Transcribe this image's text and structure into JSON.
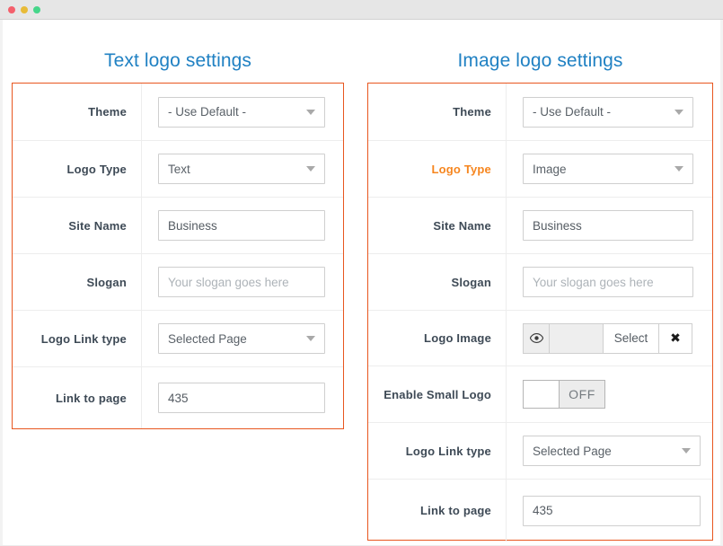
{
  "window": {
    "buttons": [
      {
        "name": "close",
        "color": "#f4606c"
      },
      {
        "name": "minimize",
        "color": "#e8bb38"
      },
      {
        "name": "maximize",
        "color": "#46d68a"
      }
    ]
  },
  "colors": {
    "panel_border": "#e8561f",
    "title": "#2081c3",
    "label": "#3e4a56",
    "accent_label": "#f6861f",
    "placeholder": "#adb3b8"
  },
  "panels": [
    {
      "id": "text-logo",
      "title": "Text logo settings",
      "rows": [
        {
          "label": "Theme",
          "accent": false,
          "control": "select",
          "value": "- Use Default -"
        },
        {
          "label": "Logo Type",
          "accent": false,
          "control": "select",
          "value": "Text"
        },
        {
          "label": "Site Name",
          "accent": false,
          "control": "input",
          "value": "Business",
          "placeholder": ""
        },
        {
          "label": "Slogan",
          "accent": false,
          "control": "input",
          "value": "",
          "placeholder": "Your slogan goes here"
        },
        {
          "label": "Logo Link type",
          "accent": false,
          "control": "select",
          "value": "Selected Page"
        },
        {
          "label": "Link to page",
          "accent": false,
          "control": "input",
          "value": "435",
          "placeholder": ""
        }
      ]
    },
    {
      "id": "image-logo",
      "title": "Image logo settings",
      "rows": [
        {
          "label": "Theme",
          "accent": false,
          "control": "select",
          "value": "- Use Default -"
        },
        {
          "label": "Logo Type",
          "accent": true,
          "control": "select",
          "value": "Image"
        },
        {
          "label": "Site Name",
          "accent": false,
          "control": "input",
          "value": "Business",
          "placeholder": ""
        },
        {
          "label": "Slogan",
          "accent": false,
          "control": "input",
          "value": "",
          "placeholder": "Your slogan goes here"
        },
        {
          "label": "Logo Image",
          "accent": false,
          "control": "filepicker",
          "preview_icon": "eye-icon",
          "preview_glyph": "ƒ",
          "file_value": "",
          "select_label": "Select",
          "clear_glyph": "✖"
        },
        {
          "label": "Enable Small Logo",
          "accent": false,
          "control": "toggle",
          "state_label": "OFF",
          "state": "off"
        },
        {
          "label": "Logo Link type",
          "accent": false,
          "control": "select",
          "value": "Selected Page"
        },
        {
          "label": "Link to page",
          "accent": false,
          "control": "input",
          "value": "435",
          "placeholder": ""
        }
      ]
    }
  ]
}
